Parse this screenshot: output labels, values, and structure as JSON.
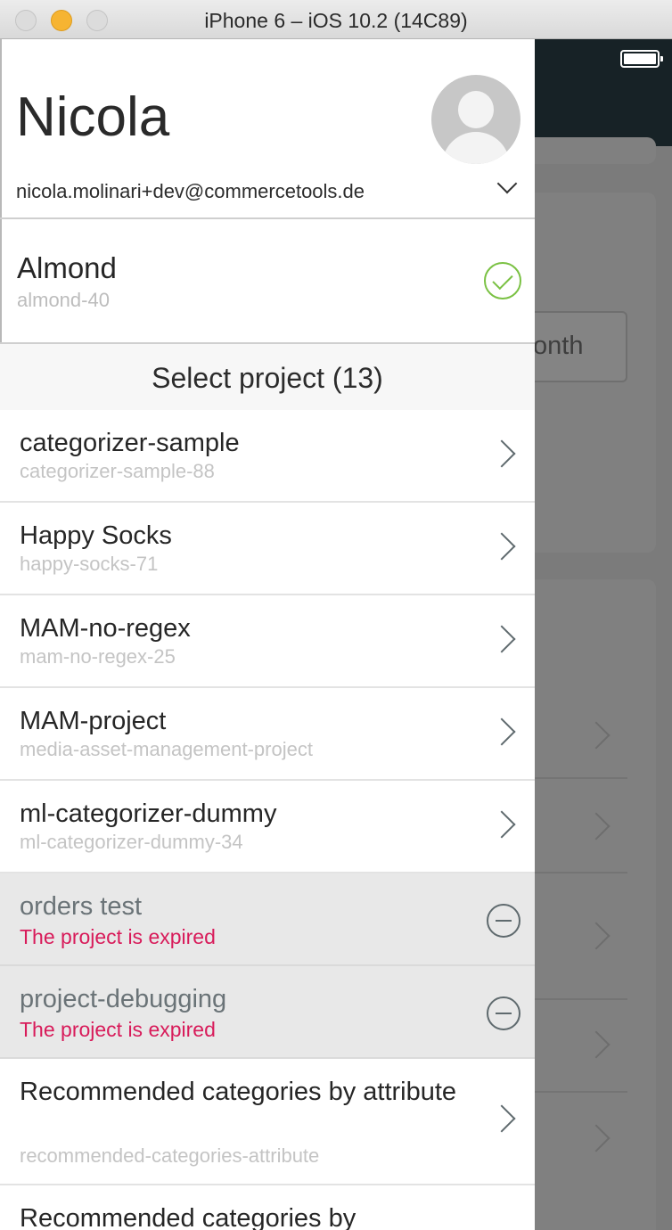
{
  "window": {
    "title": "iPhone 6 – iOS 10.2 (14C89)"
  },
  "background_app": {
    "month_label": "onth"
  },
  "drawer": {
    "user": {
      "name": "Nicola",
      "email": "nicola.molinari+dev@commercetools.de"
    },
    "current_project": {
      "name": "Almond",
      "key": "almond-40"
    },
    "select_header": "Select project (13)",
    "projects": [
      {
        "name": "categorizer-sample",
        "key": "categorizer-sample-88"
      },
      {
        "name": "Happy Socks",
        "key": "happy-socks-71"
      },
      {
        "name": "MAM-no-regex",
        "key": "mam-no-regex-25"
      },
      {
        "name": "MAM-project",
        "key": "media-asset-management-project"
      },
      {
        "name": "ml-categorizer-dummy",
        "key": "ml-categorizer-dummy-34"
      },
      {
        "name": "orders test",
        "expired_text": "The project is expired"
      },
      {
        "name": "project-debugging",
        "expired_text": "The project is expired"
      },
      {
        "name": "Recommended categories by attribute",
        "key": "recommended-categories-attribute"
      },
      {
        "name": "Recommended categories by"
      }
    ]
  },
  "colors": {
    "check": "#7ac143",
    "expired": "#d81b5a",
    "navbar": "#172226"
  }
}
